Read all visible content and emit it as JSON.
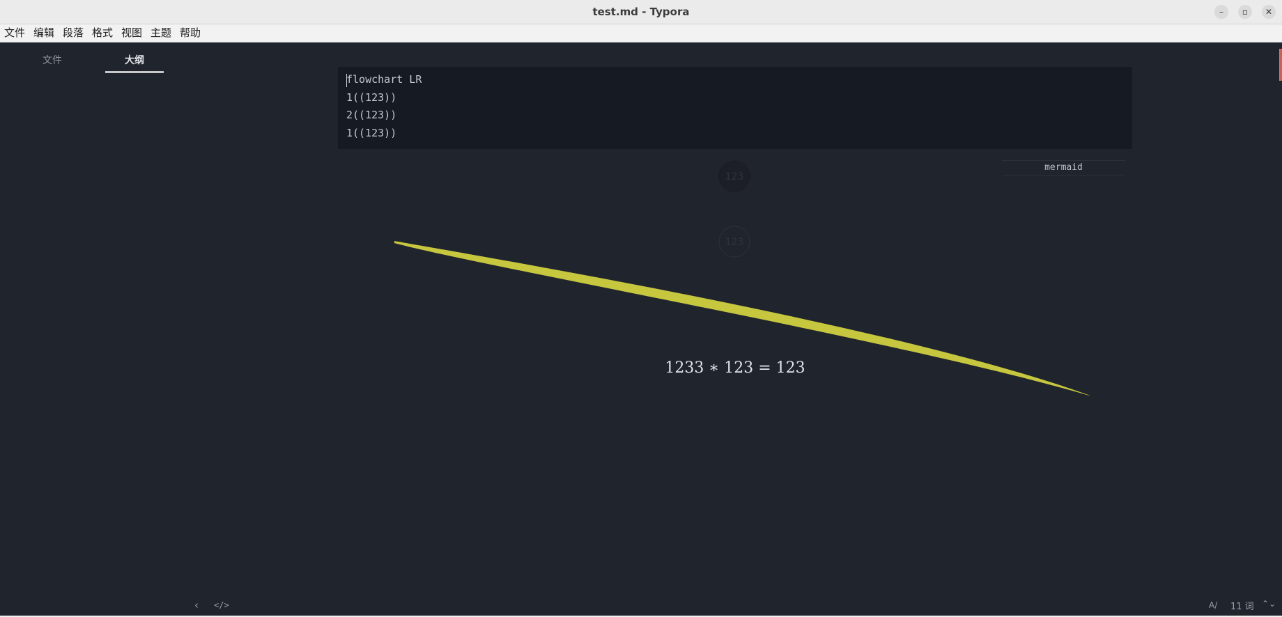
{
  "window": {
    "title": "test.md - Typora",
    "minimize_glyph": "–",
    "maximize_glyph": "▫",
    "close_glyph": "✕"
  },
  "menu": {
    "items": [
      "文件",
      "编辑",
      "段落",
      "格式",
      "视图",
      "主题",
      "帮助"
    ]
  },
  "sidebar": {
    "tabs": [
      {
        "label": "文件",
        "active": false
      },
      {
        "label": "大纲",
        "active": true
      }
    ]
  },
  "editor": {
    "code_lines": [
      "flowchart LR",
      "1((123))",
      "2((123))",
      "1((123))"
    ],
    "code_language": "mermaid",
    "diagram_nodes": [
      "123",
      "123"
    ],
    "math": "1233 ∗ 123 = 123"
  },
  "footer": {
    "back_glyph": "‹",
    "source_glyph": "</>",
    "spell_glyph": "A/",
    "word_count": "11 词",
    "updown_glyph": "⌃⌄"
  },
  "colors": {
    "background": "#20242d",
    "code_background": "#161a23",
    "node_fill": "#1c1f26",
    "arrow_fill": "#c6c73f"
  }
}
